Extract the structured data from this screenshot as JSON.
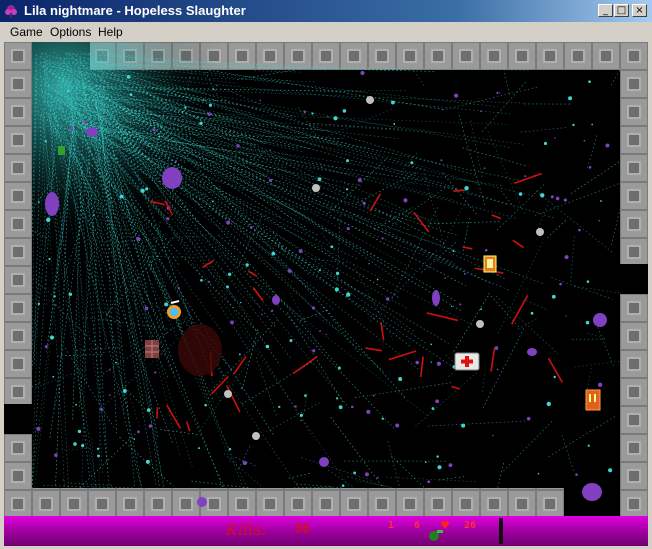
{
  "window": {
    "title": "Lila nightmare - Hopeless Slaughter",
    "buttons": {
      "minimize": "_",
      "maximize": "□",
      "close": "×"
    }
  },
  "menu": {
    "items": [
      {
        "label": "Game"
      },
      {
        "label": "Options"
      },
      {
        "label": "Help"
      }
    ]
  },
  "hud": {
    "kills_label": "Kills:",
    "kills_value": "36",
    "ammo_count": "1",
    "grenade_count": "6",
    "lives_count": "26",
    "health_level": 0.9
  },
  "colors": {
    "wall": "#8c8c8c",
    "spray": "#3fd6d0",
    "blood": "#d01010",
    "monster": "#8040c0",
    "hud_bg": "#c000c0",
    "hud_text": "#d0101a"
  },
  "icons": {
    "window": "purple-flower-icon",
    "monster": "purple-monster-icon",
    "medkit": "medkit-icon",
    "player": "player-icon"
  }
}
